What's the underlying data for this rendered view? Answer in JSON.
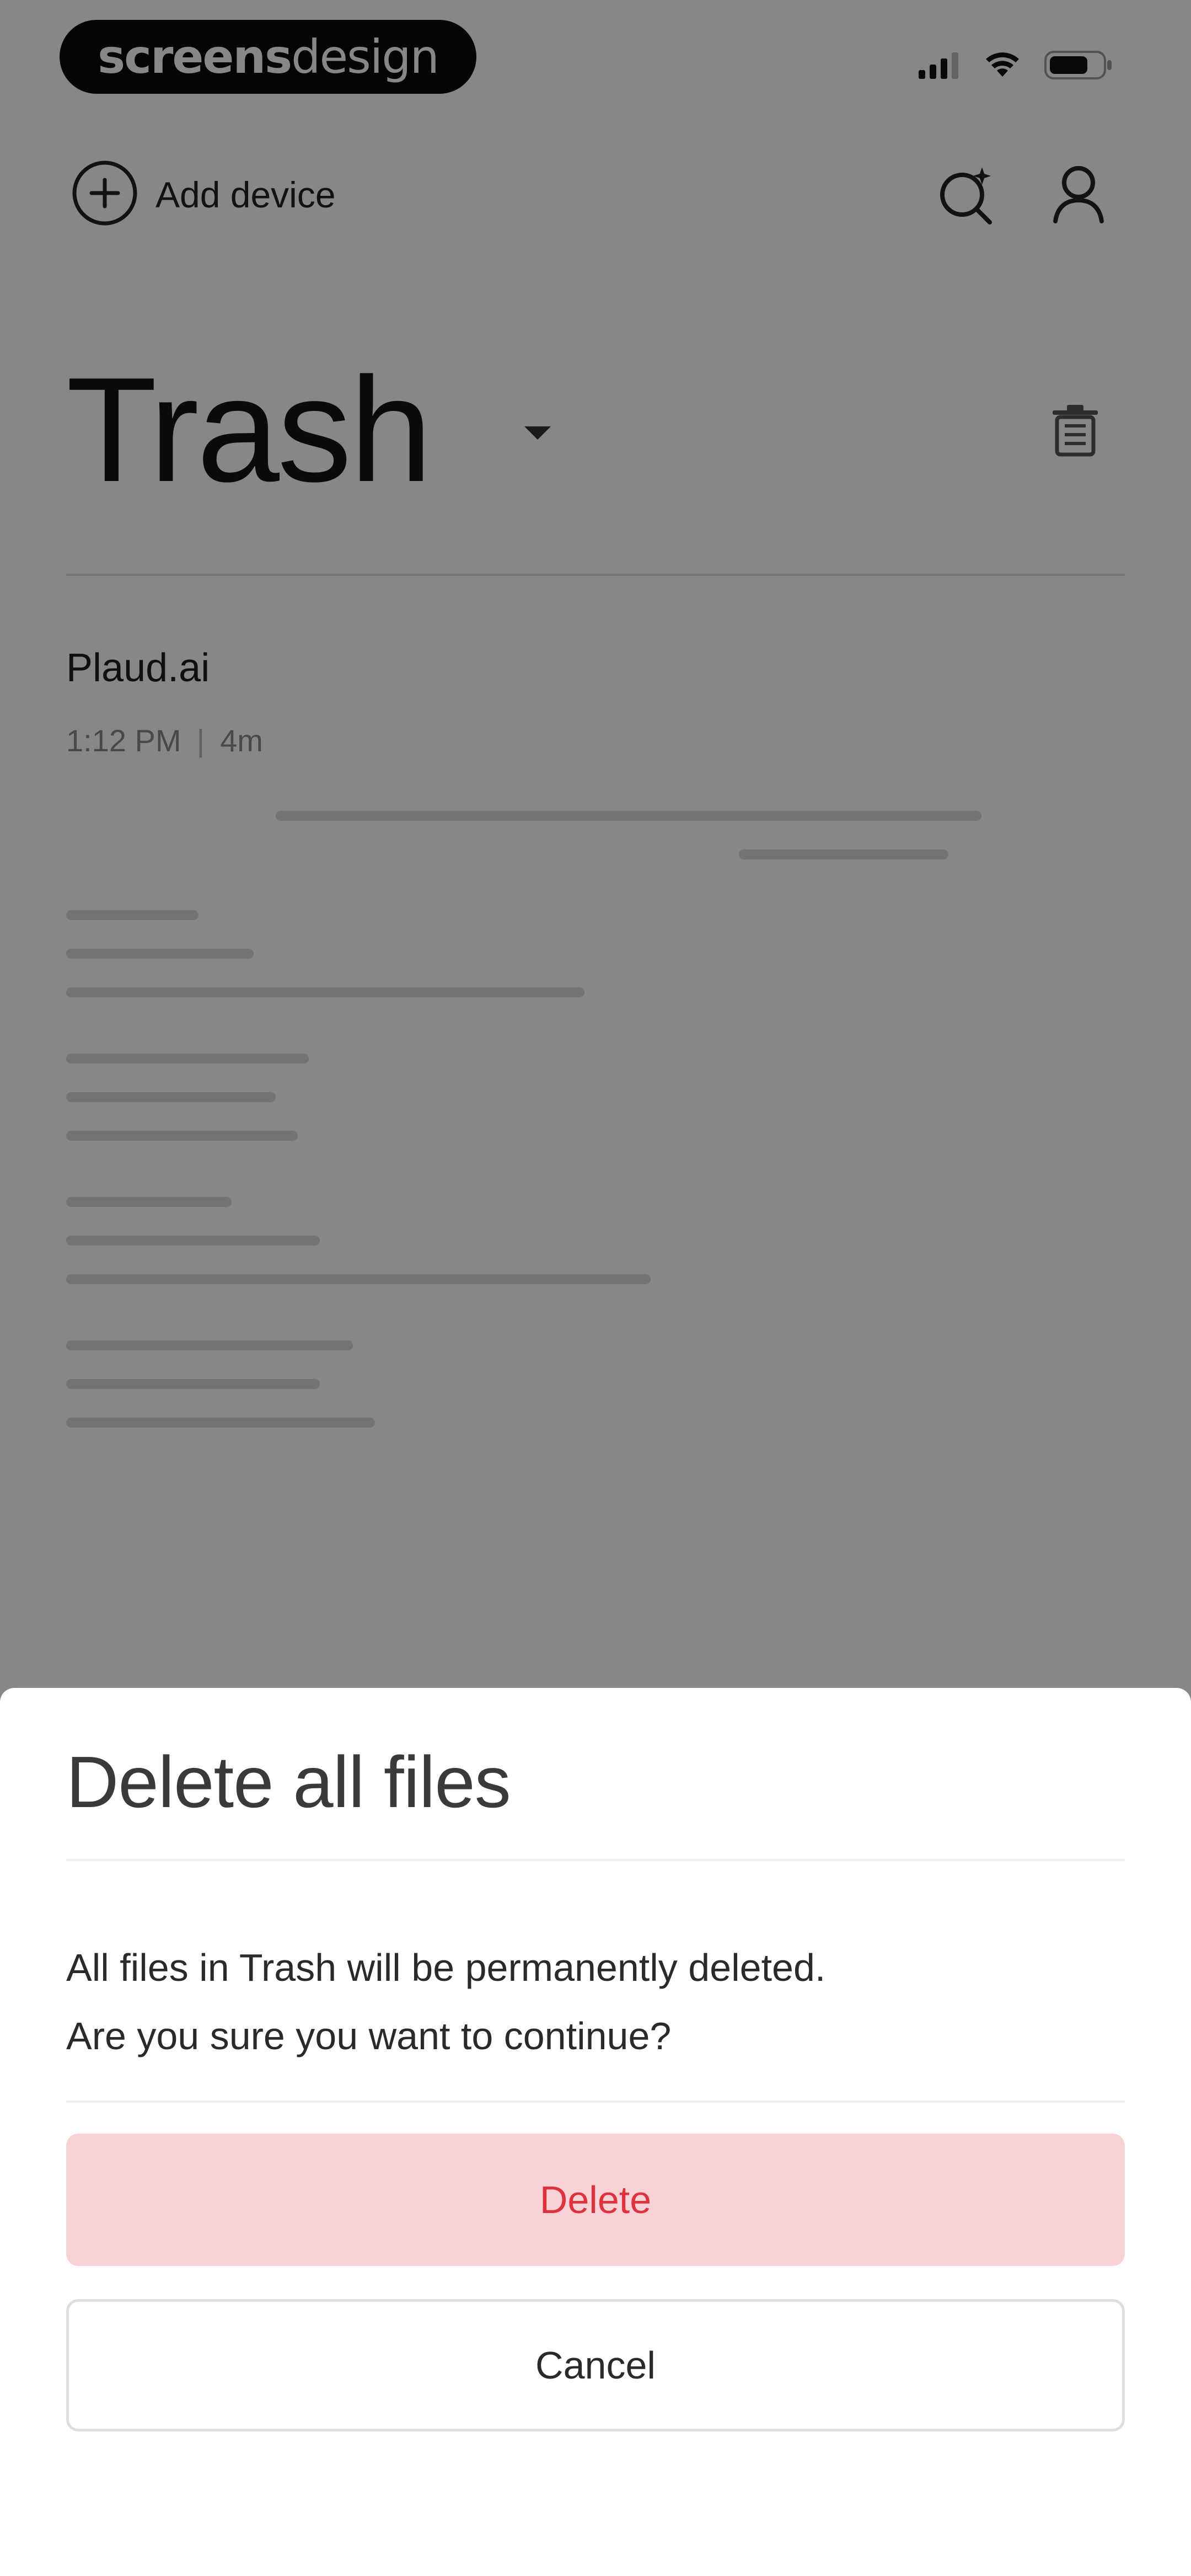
{
  "status_bar": {
    "brand_bold": "screens",
    "brand_light": "design",
    "icons": [
      "cellular-signal-icon",
      "wifi-icon",
      "battery-icon"
    ]
  },
  "nav": {
    "add_device_label": "Add device",
    "icons": [
      "add-circle-icon",
      "search-sparkle-icon",
      "profile-icon"
    ]
  },
  "page": {
    "title": "Trash",
    "title_icon": "chevron-down-icon",
    "action_icon": "trash-icon"
  },
  "files": [
    {
      "name": "Plaud.ai",
      "time": "1:12 PM",
      "separator": "|",
      "duration": "4m"
    }
  ],
  "dialog": {
    "title": "Delete all files",
    "message_line1": "All files in Trash will be permanently deleted.",
    "message_line2": "Are you sure you want to continue?",
    "delete_label": "Delete",
    "cancel_label": "Cancel"
  },
  "colors": {
    "scrim": "#000000",
    "delete_bg": "#f8d2d4",
    "delete_text": "#e0313f",
    "brand_pill": "#0a0a0a"
  }
}
